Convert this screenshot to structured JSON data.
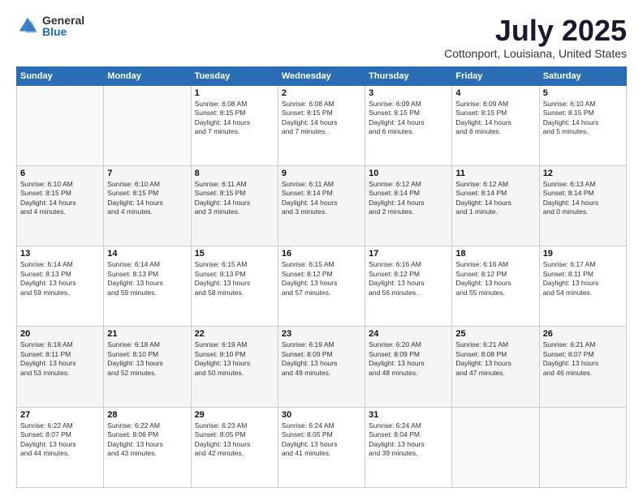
{
  "header": {
    "logo_general": "General",
    "logo_blue": "Blue",
    "month_title": "July 2025",
    "location": "Cottonport, Louisiana, United States"
  },
  "days_of_week": [
    "Sunday",
    "Monday",
    "Tuesday",
    "Wednesday",
    "Thursday",
    "Friday",
    "Saturday"
  ],
  "weeks": [
    [
      {
        "day": "",
        "info": ""
      },
      {
        "day": "",
        "info": ""
      },
      {
        "day": "1",
        "info": "Sunrise: 6:08 AM\nSunset: 8:15 PM\nDaylight: 14 hours\nand 7 minutes."
      },
      {
        "day": "2",
        "info": "Sunrise: 6:08 AM\nSunset: 8:15 PM\nDaylight: 14 hours\nand 7 minutes."
      },
      {
        "day": "3",
        "info": "Sunrise: 6:09 AM\nSunset: 8:15 PM\nDaylight: 14 hours\nand 6 minutes."
      },
      {
        "day": "4",
        "info": "Sunrise: 6:09 AM\nSunset: 8:15 PM\nDaylight: 14 hours\nand 6 minutes."
      },
      {
        "day": "5",
        "info": "Sunrise: 6:10 AM\nSunset: 8:15 PM\nDaylight: 14 hours\nand 5 minutes."
      }
    ],
    [
      {
        "day": "6",
        "info": "Sunrise: 6:10 AM\nSunset: 8:15 PM\nDaylight: 14 hours\nand 4 minutes."
      },
      {
        "day": "7",
        "info": "Sunrise: 6:10 AM\nSunset: 8:15 PM\nDaylight: 14 hours\nand 4 minutes."
      },
      {
        "day": "8",
        "info": "Sunrise: 6:11 AM\nSunset: 8:15 PM\nDaylight: 14 hours\nand 3 minutes."
      },
      {
        "day": "9",
        "info": "Sunrise: 6:11 AM\nSunset: 8:14 PM\nDaylight: 14 hours\nand 3 minutes."
      },
      {
        "day": "10",
        "info": "Sunrise: 6:12 AM\nSunset: 8:14 PM\nDaylight: 14 hours\nand 2 minutes."
      },
      {
        "day": "11",
        "info": "Sunrise: 6:12 AM\nSunset: 8:14 PM\nDaylight: 14 hours\nand 1 minute."
      },
      {
        "day": "12",
        "info": "Sunrise: 6:13 AM\nSunset: 8:14 PM\nDaylight: 14 hours\nand 0 minutes."
      }
    ],
    [
      {
        "day": "13",
        "info": "Sunrise: 6:14 AM\nSunset: 8:13 PM\nDaylight: 13 hours\nand 59 minutes."
      },
      {
        "day": "14",
        "info": "Sunrise: 6:14 AM\nSunset: 8:13 PM\nDaylight: 13 hours\nand 59 minutes."
      },
      {
        "day": "15",
        "info": "Sunrise: 6:15 AM\nSunset: 8:13 PM\nDaylight: 13 hours\nand 58 minutes."
      },
      {
        "day": "16",
        "info": "Sunrise: 6:15 AM\nSunset: 8:12 PM\nDaylight: 13 hours\nand 57 minutes."
      },
      {
        "day": "17",
        "info": "Sunrise: 6:16 AM\nSunset: 8:12 PM\nDaylight: 13 hours\nand 56 minutes."
      },
      {
        "day": "18",
        "info": "Sunrise: 6:16 AM\nSunset: 8:12 PM\nDaylight: 13 hours\nand 55 minutes."
      },
      {
        "day": "19",
        "info": "Sunrise: 6:17 AM\nSunset: 8:11 PM\nDaylight: 13 hours\nand 54 minutes."
      }
    ],
    [
      {
        "day": "20",
        "info": "Sunrise: 6:18 AM\nSunset: 8:11 PM\nDaylight: 13 hours\nand 53 minutes."
      },
      {
        "day": "21",
        "info": "Sunrise: 6:18 AM\nSunset: 8:10 PM\nDaylight: 13 hours\nand 52 minutes."
      },
      {
        "day": "22",
        "info": "Sunrise: 6:19 AM\nSunset: 8:10 PM\nDaylight: 13 hours\nand 50 minutes."
      },
      {
        "day": "23",
        "info": "Sunrise: 6:19 AM\nSunset: 8:09 PM\nDaylight: 13 hours\nand 49 minutes."
      },
      {
        "day": "24",
        "info": "Sunrise: 6:20 AM\nSunset: 8:09 PM\nDaylight: 13 hours\nand 48 minutes."
      },
      {
        "day": "25",
        "info": "Sunrise: 6:21 AM\nSunset: 8:08 PM\nDaylight: 13 hours\nand 47 minutes."
      },
      {
        "day": "26",
        "info": "Sunrise: 6:21 AM\nSunset: 8:07 PM\nDaylight: 13 hours\nand 46 minutes."
      }
    ],
    [
      {
        "day": "27",
        "info": "Sunrise: 6:22 AM\nSunset: 8:07 PM\nDaylight: 13 hours\nand 44 minutes."
      },
      {
        "day": "28",
        "info": "Sunrise: 6:22 AM\nSunset: 8:06 PM\nDaylight: 13 hours\nand 43 minutes."
      },
      {
        "day": "29",
        "info": "Sunrise: 6:23 AM\nSunset: 8:05 PM\nDaylight: 13 hours\nand 42 minutes."
      },
      {
        "day": "30",
        "info": "Sunrise: 6:24 AM\nSunset: 8:05 PM\nDaylight: 13 hours\nand 41 minutes."
      },
      {
        "day": "31",
        "info": "Sunrise: 6:24 AM\nSunset: 8:04 PM\nDaylight: 13 hours\nand 39 minutes."
      },
      {
        "day": "",
        "info": ""
      },
      {
        "day": "",
        "info": ""
      }
    ]
  ]
}
